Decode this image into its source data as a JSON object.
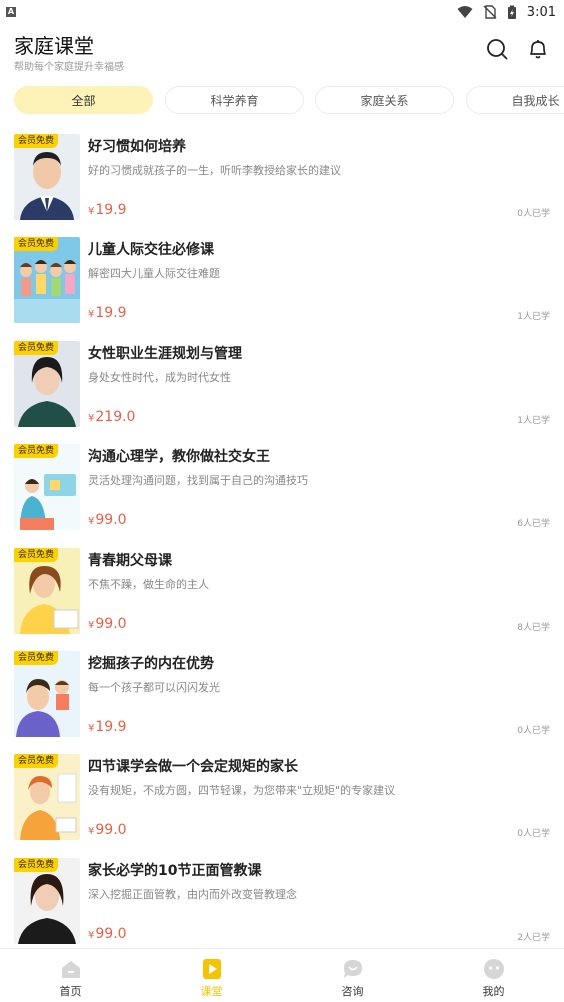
{
  "status_bar": {
    "time": "3:01",
    "left_glyph": "A"
  },
  "header": {
    "title": "家庭课堂",
    "subtitle": "帮助每个家庭提升幸福感"
  },
  "tabs": [
    {
      "label": "全部",
      "active": true
    },
    {
      "label": "科学养育",
      "active": false
    },
    {
      "label": "家庭关系",
      "active": false
    },
    {
      "label": "自我成长",
      "active": false
    }
  ],
  "courses": [
    {
      "badge": "会员免费",
      "title": "好习惯如何培养",
      "desc": "好的习惯成就孩子的一生，听听李教授给家长的建议",
      "currency": "¥",
      "price": "19.9",
      "learned": "0人已学"
    },
    {
      "badge": "会员免费",
      "title": "儿童人际交往必修课",
      "desc": "解密四大儿童人际交往难题",
      "currency": "¥",
      "price": "19.9",
      "learned": "1人已学"
    },
    {
      "badge": "会员免费",
      "title": "女性职业生涯规划与管理",
      "desc": "身处女性时代，成为时代女性",
      "currency": "¥",
      "price": "219.0",
      "learned": "1人已学"
    },
    {
      "badge": "会员免费",
      "title": "沟通心理学，教你做社交女王",
      "desc": "灵活处理沟通问题，找到属于自己的沟通技巧",
      "currency": "¥",
      "price": "99.0",
      "learned": "6人已学"
    },
    {
      "badge": "会员免费",
      "title": "青春期父母课",
      "desc": "不焦不躁，做生命的主人",
      "currency": "¥",
      "price": "99.0",
      "learned": "8人已学"
    },
    {
      "badge": "会员免费",
      "title": "挖掘孩子的内在优势",
      "desc": "每一个孩子都可以闪闪发光",
      "currency": "¥",
      "price": "19.9",
      "learned": "0人已学"
    },
    {
      "badge": "会员免费",
      "title": "四节课学会做一个会定规矩的家长",
      "desc": "没有规矩，不成方圆，四节轻课，为您带来\"立规矩\"的专家建议",
      "currency": "¥",
      "price": "99.0",
      "learned": "0人已学"
    },
    {
      "badge": "会员免费",
      "title": "家长必学的10节正面管教课",
      "desc": "深入挖掘正面管教，由内而外改变管教理念",
      "currency": "¥",
      "price": "99.0",
      "learned": "2人已学"
    }
  ],
  "bottom_nav": [
    {
      "label": "首页",
      "icon": "home-icon",
      "active": false
    },
    {
      "label": "课堂",
      "icon": "play-icon",
      "active": true
    },
    {
      "label": "咨询",
      "icon": "chat-icon",
      "active": false
    },
    {
      "label": "我的",
      "icon": "profile-icon",
      "active": false
    }
  ],
  "colors": {
    "accent": "#fbd100",
    "tab_active_bg": "#fdf2b8",
    "price": "#e8604a"
  }
}
